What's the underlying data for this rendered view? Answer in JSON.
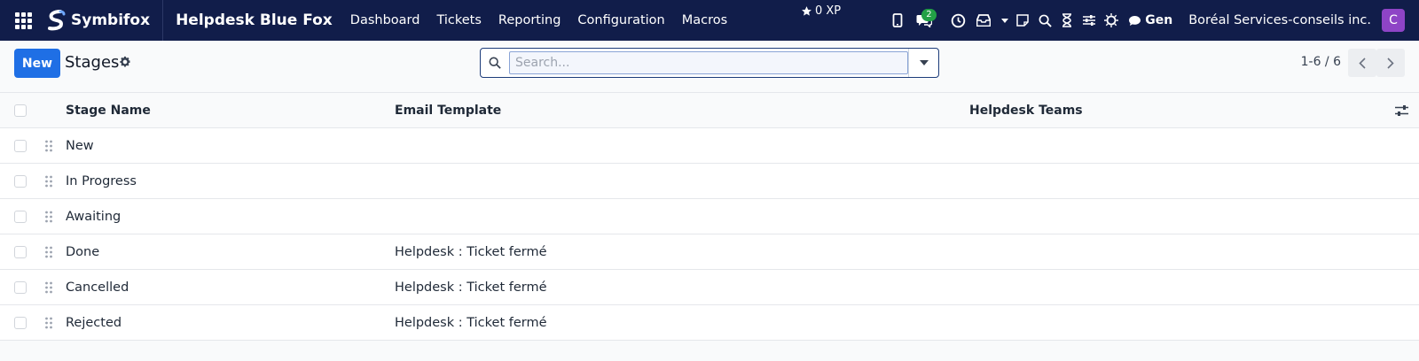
{
  "navbar": {
    "brand": "Symbifox",
    "app_title": "Helpdesk Blue Fox",
    "menu": [
      "Dashboard",
      "Tickets",
      "Reporting",
      "Configuration",
      "Macros"
    ],
    "xp": "0 XP",
    "chat_badge": "2",
    "gen_label": "Gen",
    "company": "Boréal Services-conseils inc.",
    "avatar_initial": "C",
    "avatar_color": "#8e44c6",
    "bg_color": "#111d4a"
  },
  "control": {
    "new_label": "New",
    "title": "Stages",
    "search_placeholder": "Search...",
    "pager": "1-6 / 6"
  },
  "table": {
    "columns": [
      "Stage Name",
      "Email Template",
      "Helpdesk Teams"
    ],
    "rows": [
      {
        "name": "New",
        "email": "",
        "teams": ""
      },
      {
        "name": "In Progress",
        "email": "",
        "teams": ""
      },
      {
        "name": "Awaiting",
        "email": "",
        "teams": ""
      },
      {
        "name": "Done",
        "email": "Helpdesk : Ticket fermé",
        "teams": ""
      },
      {
        "name": "Cancelled",
        "email": "Helpdesk : Ticket fermé",
        "teams": ""
      },
      {
        "name": "Rejected",
        "email": "Helpdesk : Ticket fermé",
        "teams": ""
      }
    ]
  },
  "colors": {
    "primary": "#1f6fe5",
    "badge": "#22a046"
  }
}
